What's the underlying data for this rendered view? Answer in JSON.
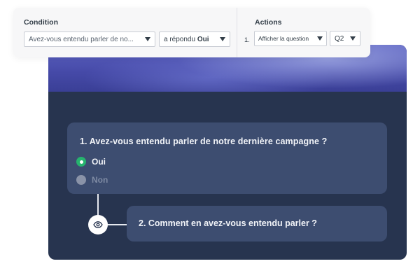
{
  "logic_panel": {
    "condition_label": "Condition",
    "question_select": "Avez-vous entendu parler de no...",
    "answer_select_prefix": "a répondu",
    "answer_select_value": "Oui",
    "actions_label": "Actions",
    "action_row_number": "1.",
    "action_select": "Afficher la question",
    "target_select": "Q2"
  },
  "survey": {
    "q1": {
      "title": "1. Avez-vous entendu parler de notre dernière campagne ?",
      "options": [
        {
          "label": "Oui",
          "selected": true
        },
        {
          "label": "Non",
          "selected": false
        }
      ]
    },
    "q2": {
      "title": "2. Comment en avez-vous entendu parler ?"
    },
    "connector_icon": "eye-icon"
  },
  "colors": {
    "card_bg": "#27344f",
    "question_bg": "#3d4d70",
    "selected_radio": "#26b36e",
    "banner": "#4549a7"
  }
}
